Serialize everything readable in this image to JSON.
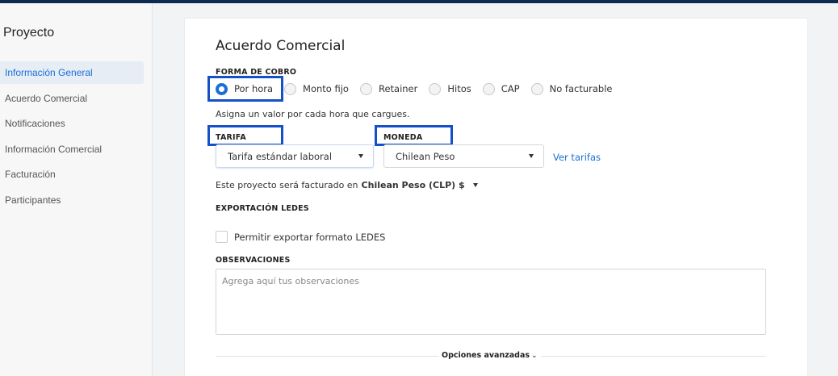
{
  "sidebar": {
    "title": "Proyecto",
    "items": [
      {
        "label": "Información General",
        "active": true
      },
      {
        "label": "Acuerdo Comercial",
        "active": false
      },
      {
        "label": "Notificaciones",
        "active": false
      },
      {
        "label": "Información Comercial",
        "active": false
      },
      {
        "label": "Facturación",
        "active": false
      },
      {
        "label": "Participantes",
        "active": false
      }
    ]
  },
  "main": {
    "title": "Acuerdo Comercial",
    "billing_form_label": "FORMA DE COBRO",
    "billing_options": [
      {
        "label": "Por hora",
        "selected": true
      },
      {
        "label": "Monto fijo",
        "selected": false
      },
      {
        "label": "Retainer",
        "selected": false
      },
      {
        "label": "Hitos",
        "selected": false
      },
      {
        "label": "CAP",
        "selected": false
      },
      {
        "label": "No facturable",
        "selected": false
      }
    ],
    "hint": "Asigna un valor por cada hora que cargues.",
    "rate": {
      "label": "TARIFA",
      "value": "Tarifa estándar laboral"
    },
    "currency": {
      "label": "MONEDA",
      "value": "Chilean Peso"
    },
    "rates_link": "Ver tarifas",
    "billed_prefix": "Este proyecto será facturado en",
    "billed_value": "Chilean Peso (CLP) $",
    "ledes": {
      "label": "EXPORTACIÓN LEDES",
      "checkbox_label": "Permitir exportar formato LEDES",
      "checked": false
    },
    "observations": {
      "label": "OBSERVACIONES",
      "placeholder": "Agrega aquí tus observaciones",
      "value": ""
    },
    "advanced_options": "Opciones avanzadas"
  },
  "colors": {
    "accent": "#1a6fd6",
    "highlight_box": "#1450c8",
    "topbar": "#0d2b50"
  }
}
